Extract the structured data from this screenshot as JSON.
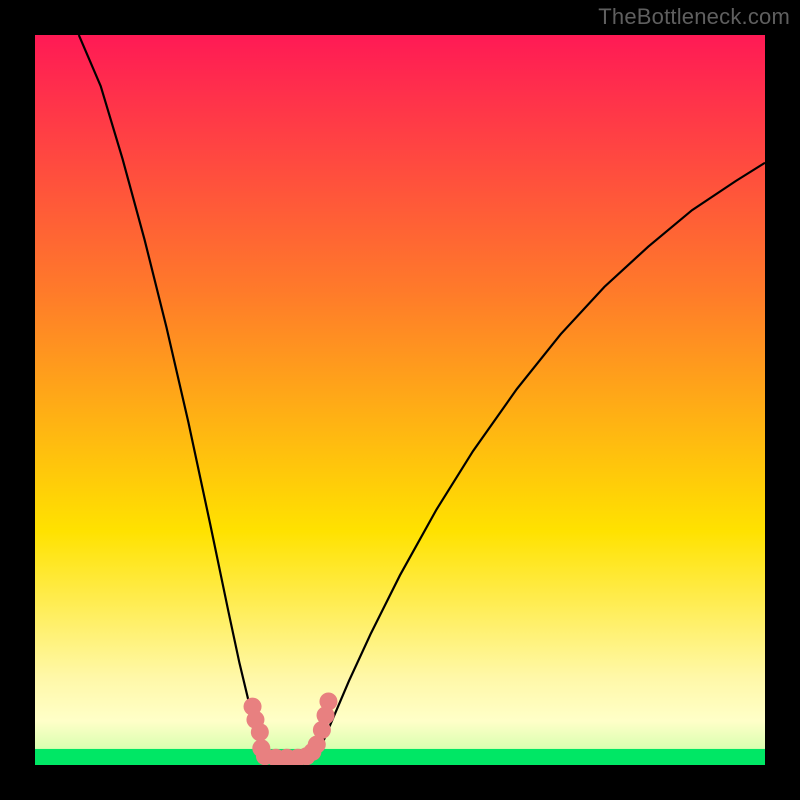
{
  "attribution": "TheBottleneck.com",
  "colors": {
    "frame": "#000000",
    "gradient_top": "#ff1a55",
    "gradient_mid1": "#ff7a2a",
    "gradient_mid2": "#ffe200",
    "gradient_pale": "#ffffaa",
    "gradient_green": "#00e765",
    "curve": "#000000",
    "marker_fill": "#e88080",
    "marker_stroke": "#c75858"
  },
  "chart_data": {
    "type": "line",
    "title": "",
    "xlabel": "",
    "ylabel": "",
    "xlim": [
      0,
      1
    ],
    "ylim": [
      0,
      1
    ],
    "curve_left": {
      "comment": "Steep descending branch from top-left toward the valley floor near x≈0.30",
      "points": [
        [
          0.06,
          1.0
        ],
        [
          0.09,
          0.93
        ],
        [
          0.12,
          0.83
        ],
        [
          0.15,
          0.72
        ],
        [
          0.18,
          0.6
        ],
        [
          0.21,
          0.47
        ],
        [
          0.24,
          0.33
        ],
        [
          0.265,
          0.21
        ],
        [
          0.28,
          0.14
        ],
        [
          0.292,
          0.09
        ],
        [
          0.3,
          0.06
        ],
        [
          0.308,
          0.033
        ],
        [
          0.315,
          0.012
        ]
      ]
    },
    "curve_right": {
      "comment": "Gently rising branch from valley near x≈0.39 up toward the upper-right",
      "points": [
        [
          0.388,
          0.015
        ],
        [
          0.398,
          0.04
        ],
        [
          0.41,
          0.068
        ],
        [
          0.43,
          0.115
        ],
        [
          0.46,
          0.18
        ],
        [
          0.5,
          0.26
        ],
        [
          0.55,
          0.35
        ],
        [
          0.6,
          0.43
        ],
        [
          0.66,
          0.515
        ],
        [
          0.72,
          0.59
        ],
        [
          0.78,
          0.655
        ],
        [
          0.84,
          0.71
        ],
        [
          0.9,
          0.76
        ],
        [
          0.96,
          0.8
        ],
        [
          1.0,
          0.825
        ]
      ]
    },
    "markers": {
      "comment": "Pink dotted markers clustered near the valley bottom, forming a shallow U",
      "points": [
        [
          0.298,
          0.08
        ],
        [
          0.302,
          0.062
        ],
        [
          0.308,
          0.045
        ],
        [
          0.31,
          0.023
        ],
        [
          0.315,
          0.012
        ],
        [
          0.33,
          0.01
        ],
        [
          0.345,
          0.01
        ],
        [
          0.36,
          0.01
        ],
        [
          0.372,
          0.012
        ],
        [
          0.38,
          0.018
        ],
        [
          0.386,
          0.028
        ],
        [
          0.393,
          0.048
        ],
        [
          0.398,
          0.068
        ],
        [
          0.402,
          0.087
        ]
      ]
    },
    "green_band": {
      "comment": "Thin bright-green horizontal band at the very bottom of the plot area",
      "y_start": 0.0,
      "y_end": 0.022
    }
  }
}
